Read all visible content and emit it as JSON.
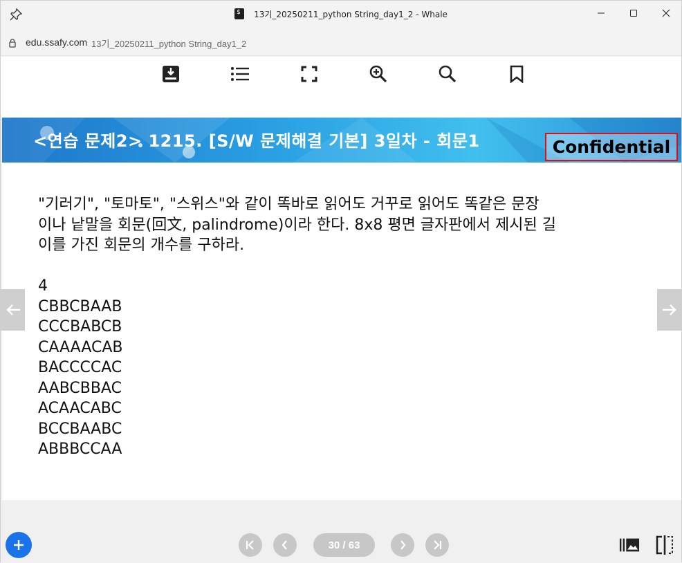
{
  "window": {
    "title": "13기_20250211_python String_day1_2 - Whale"
  },
  "address": {
    "domain": "edu.ssafy.com",
    "path": "13기_20250211_python String_day1_2"
  },
  "toolbar": {
    "icons": [
      "download-icon",
      "list-icon",
      "fullscreen-icon",
      "zoom-in-icon",
      "search-icon",
      "bookmark-icon"
    ]
  },
  "slide": {
    "banner_title": "<연습 문제2> 1215. [S/W 문제해결 기본] 3일차 - 회문1",
    "confidential": "Confidential",
    "description_lines": [
      "\"기러기\", \"토마토\", \"스위스\"와 같이 똑바로 읽어도 거꾸로 읽어도 똑같은 문장",
      "이나 낱말을 회문(回文, palindrome)이라 한다. 8x8 평면 글자판에서 제시된 길",
      "이를 가진 회문의 개수를 구하라."
    ],
    "input_lines": [
      "4",
      "CBBCBAAB",
      "CCCBABCB",
      "CAAAACAB",
      "BACCCCAC",
      "AABCBBAC",
      "ACAACABC",
      "BCCBAABC",
      "ABBBCCAA"
    ]
  },
  "pager": {
    "page_indicator": "30 / 63",
    "current_page": 30,
    "total_pages": 63
  },
  "colors": {
    "banner_gradient_start": "#1d76c9",
    "banner_gradient_end": "#41bfee",
    "confidential_border": "#e01010",
    "fab": "#1a73e8"
  }
}
